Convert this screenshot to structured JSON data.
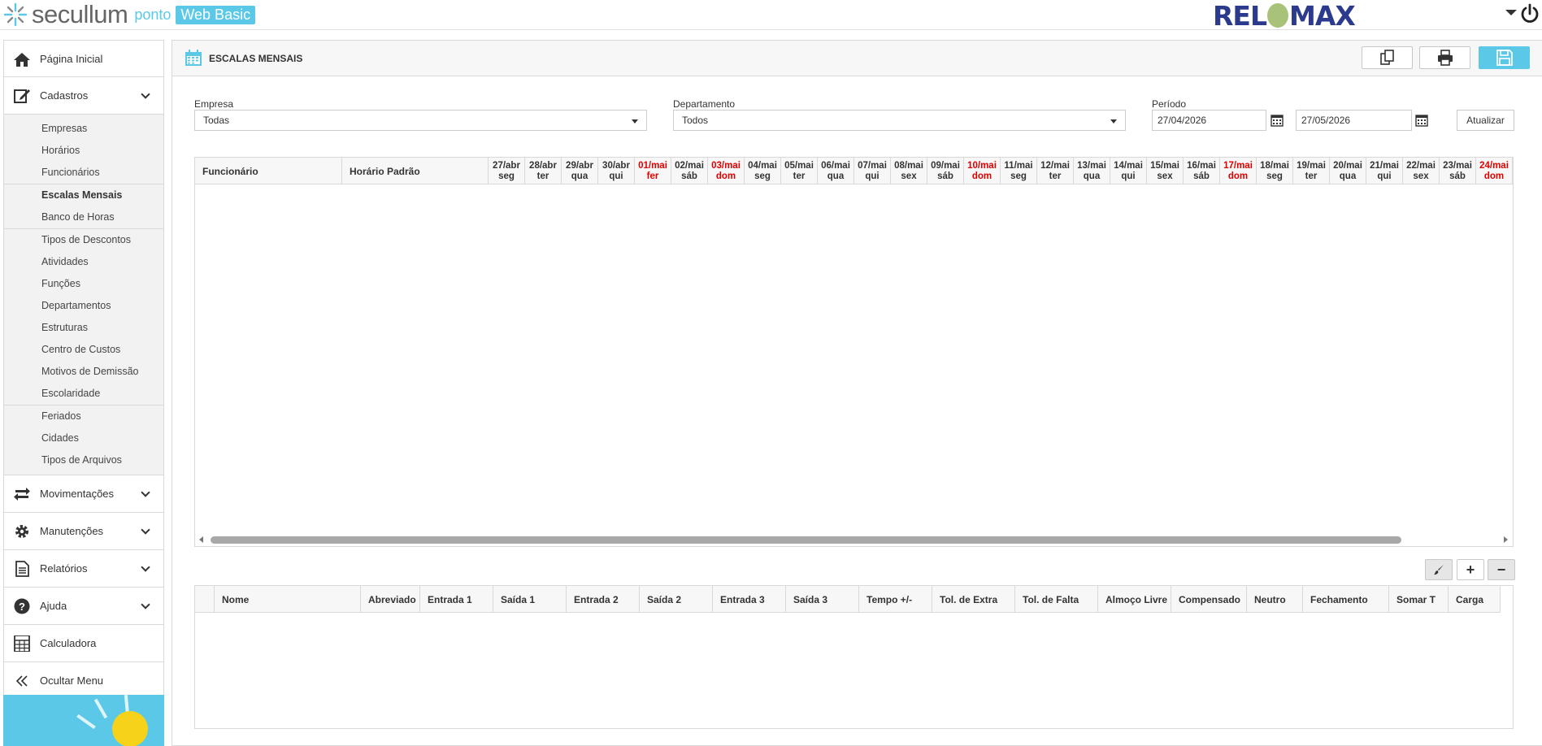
{
  "header": {
    "brand_word": "secullum",
    "brand_ponto": "ponto",
    "brand_web": "Web Basic",
    "partner_logo_left": "REL",
    "partner_logo_right": "MAX"
  },
  "sidebar": {
    "pagina_inicial": "Página Inicial",
    "cadastros": "Cadastros",
    "cadastros_items": {
      "group1": [
        "Empresas",
        "Horários",
        "Funcionários"
      ],
      "group2": [
        "Escalas Mensais",
        "Banco de Horas"
      ],
      "group3": [
        "Tipos de Descontos",
        "Atividades",
        "Funções",
        "Departamentos",
        "Estruturas",
        "Centro de Custos",
        "Motivos de Demissão",
        "Escolaridade"
      ],
      "group4": [
        "Feriados",
        "Cidades",
        "Tipos de Arquivos"
      ]
    },
    "active_item": "Escalas Mensais",
    "movimentacoes": "Movimentações",
    "manutencoes": "Manutenções",
    "relatorios": "Relatórios",
    "ajuda": "Ajuda",
    "calculadora": "Calculadora",
    "ocultar_menu": "Ocultar Menu"
  },
  "page": {
    "title": "ESCALAS MENSAIS"
  },
  "filters": {
    "empresa_label": "Empresa",
    "empresa_value": "Todas",
    "departamento_label": "Departamento",
    "departamento_value": "Todos",
    "periodo_label": "Período",
    "date_from": "27/04/2026",
    "date_to": "27/05/2026",
    "atualizar": "Atualizar"
  },
  "schedule_grid": {
    "col_funcionario": "Funcionário",
    "col_horario": "Horário Padrão",
    "days": [
      {
        "date": "27/abr",
        "dow": "seg",
        "holiday": false
      },
      {
        "date": "28/abr",
        "dow": "ter",
        "holiday": false
      },
      {
        "date": "29/abr",
        "dow": "qua",
        "holiday": false
      },
      {
        "date": "30/abr",
        "dow": "qui",
        "holiday": false
      },
      {
        "date": "01/mai",
        "dow": "fer",
        "holiday": true
      },
      {
        "date": "02/mai",
        "dow": "sáb",
        "holiday": false
      },
      {
        "date": "03/mai",
        "dow": "dom",
        "holiday": true
      },
      {
        "date": "04/mai",
        "dow": "seg",
        "holiday": false
      },
      {
        "date": "05/mai",
        "dow": "ter",
        "holiday": false
      },
      {
        "date": "06/mai",
        "dow": "qua",
        "holiday": false
      },
      {
        "date": "07/mai",
        "dow": "qui",
        "holiday": false
      },
      {
        "date": "08/mai",
        "dow": "sex",
        "holiday": false
      },
      {
        "date": "09/mai",
        "dow": "sáb",
        "holiday": false
      },
      {
        "date": "10/mai",
        "dow": "dom",
        "holiday": true
      },
      {
        "date": "11/mai",
        "dow": "seg",
        "holiday": false
      },
      {
        "date": "12/mai",
        "dow": "ter",
        "holiday": false
      },
      {
        "date": "13/mai",
        "dow": "qua",
        "holiday": false
      },
      {
        "date": "14/mai",
        "dow": "qui",
        "holiday": false
      },
      {
        "date": "15/mai",
        "dow": "sex",
        "holiday": false
      },
      {
        "date": "16/mai",
        "dow": "sáb",
        "holiday": false
      },
      {
        "date": "17/mai",
        "dow": "dom",
        "holiday": true
      },
      {
        "date": "18/mai",
        "dow": "seg",
        "holiday": false
      },
      {
        "date": "19/mai",
        "dow": "ter",
        "holiday": false
      },
      {
        "date": "20/mai",
        "dow": "qua",
        "holiday": false
      },
      {
        "date": "21/mai",
        "dow": "qui",
        "holiday": false
      },
      {
        "date": "22/mai",
        "dow": "sex",
        "holiday": false
      },
      {
        "date": "23/mai",
        "dow": "sáb",
        "holiday": false
      },
      {
        "date": "24/mai",
        "dow": "dom",
        "holiday": true
      }
    ],
    "holiday_color": "#e00000"
  },
  "schedule_buttons": {
    "add": "+",
    "remove": "−"
  },
  "hours_grid": {
    "columns": [
      "Nome",
      "Abreviado",
      "Entrada 1",
      "Saída 1",
      "Entrada 2",
      "Saída 2",
      "Entrada 3",
      "Saída 3",
      "Tempo +/-",
      "Tol. de Extra",
      "Tol. de Falta",
      "Almoço Livre",
      "Compensado",
      "Neutro",
      "Fechamento",
      "Somar T",
      "Carga"
    ]
  },
  "colors": {
    "accent": "#5bc8e8",
    "brand_blue": "#2b3a8c"
  },
  "icons": {
    "home": "home-icon",
    "cadastros": "edit-icon",
    "movimentacoes": "transfer-icon",
    "manutencoes": "gear-icon",
    "relatorios": "document-icon",
    "ajuda": "help-icon",
    "calculadora": "calculator-icon",
    "ocultar": "double-chevron-left-icon",
    "copy": "copy-icon",
    "print": "print-icon",
    "save": "save-icon",
    "calendar": "calendar-icon",
    "brush": "brush-icon",
    "power": "power-icon"
  }
}
